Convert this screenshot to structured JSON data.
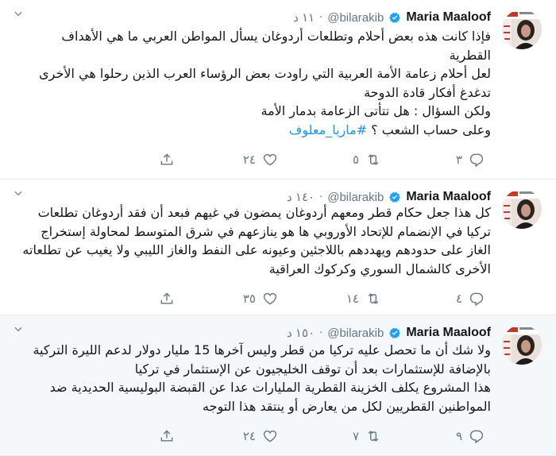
{
  "colors": {
    "accent": "#1b95e0",
    "muted": "#657786",
    "verified": "#1da1f2",
    "border": "#e6ecf0"
  },
  "tweets": [
    {
      "author": {
        "name": "Maria Maaloof",
        "handle": "@bilarakib"
      },
      "time": "١١ د",
      "lines": [
        "فإذا كانت هذه بعض أحلام وتطلعات أردوغان يسأل المواطن العربي ما هي الأهداف القطرية",
        "لعل أحلام زعامة الأمة العربية التي راودت بعض الرؤساء العرب الذين رحلوا هي الأخرى تدغدغ أفكار قادة الدوحة",
        "ولكن السؤال : هل تتأتى الزعامة بدمار الأمة"
      ],
      "last_line": "وعلى حساب الشعب ؟",
      "hashtag": "#ماريا_معلوف",
      "replies": "٣",
      "retweets": "٥",
      "likes": "٢٤"
    },
    {
      "author": {
        "name": "Maria Maaloof",
        "handle": "@bilarakib"
      },
      "time": "١٤٠ د",
      "lines": [
        "كل هذا جعل حكام قطر ومعهم أردوغان يمضون في غيهم فبعد أن فقد أردوغان تطلعات تركيا في الإنضمام للإتحاد الأوروبي ها هو ينازعهم في شرق المتوسط لمحاولة إستخراج الغاز على حدودهم ويهددهم باللاجئين وعيونه على النفط والغاز الليبي ولا يغيب عن تطلعاته الأخرى كالشمال السوري وكركوك العراقية"
      ],
      "replies": "٤",
      "retweets": "١٤",
      "likes": "٣٥"
    },
    {
      "author": {
        "name": "Maria Maaloof",
        "handle": "@bilarakib"
      },
      "time": "١٥٠ د",
      "lines": [
        "ولا شك أن ما تحصل عليه تركيا من قطر وليس آخرها 15 مليار دولار لدعم الليرة التركية بالإضافة للإستثمارات بعد أن توقف الخليجيون عن الإستثمار في تركيا",
        "هذا المشروع يكلف الخزينة القطرية المليارات عدا عن القبضة البوليسية الحديدية ضد المواطنين القطريين لكل من يعارض أو ينتقد هذا التوجه"
      ],
      "replies": "٩",
      "retweets": "٧",
      "likes": "٢٤"
    }
  ]
}
